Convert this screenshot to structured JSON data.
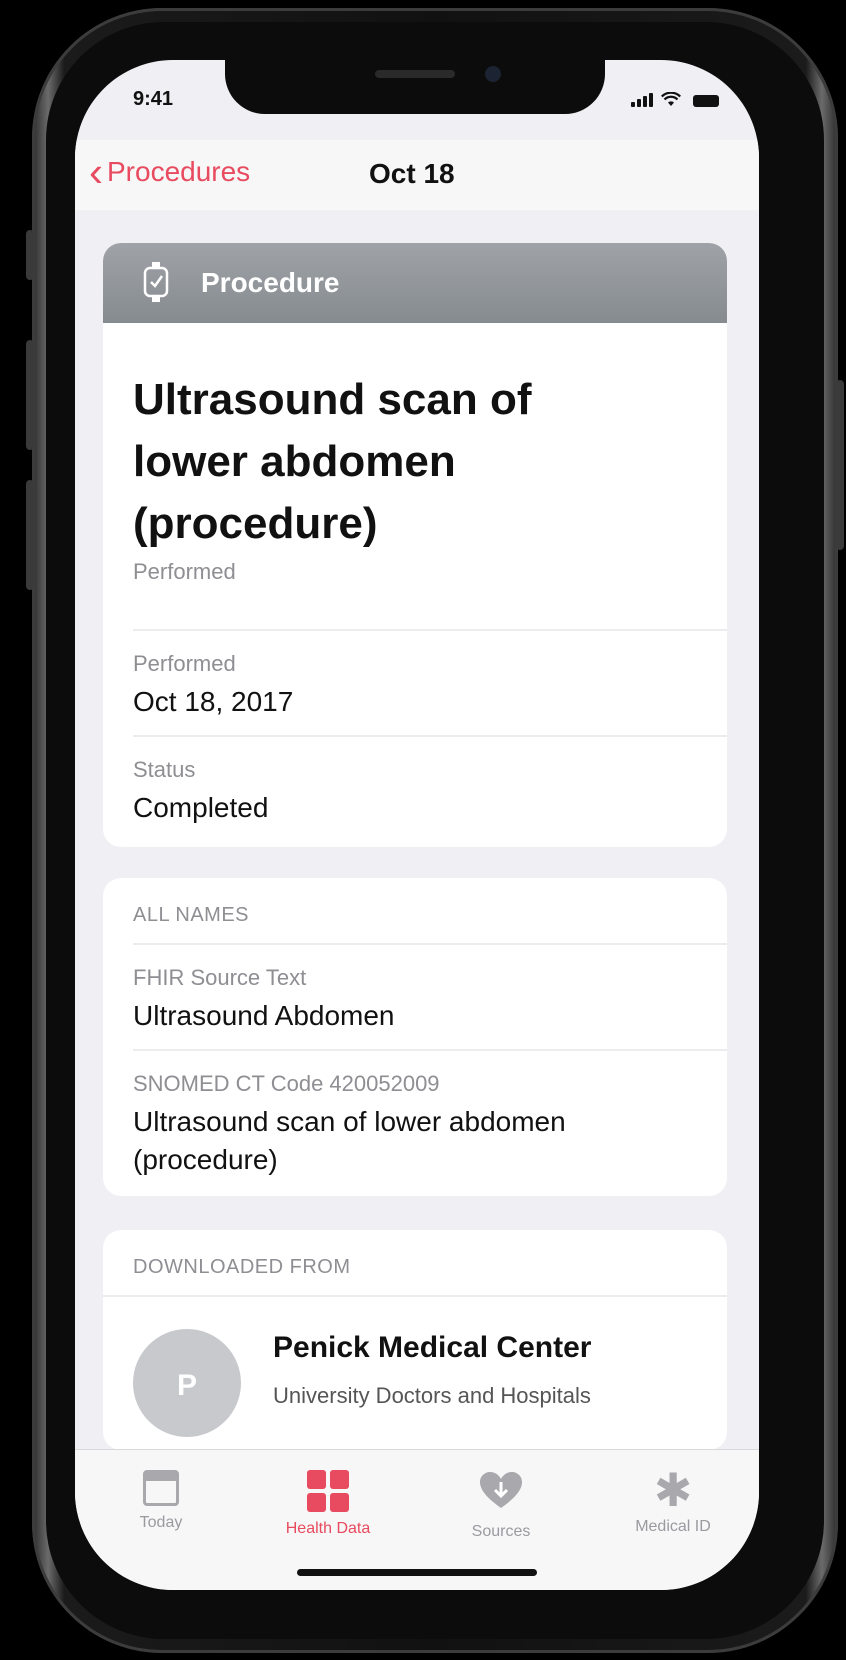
{
  "status_bar": {
    "time": "9:41"
  },
  "nav": {
    "back_label": "Procedures",
    "title": "Oct 18"
  },
  "procedure_card": {
    "header_label": "Procedure",
    "title_line1": "Ultrasound scan of",
    "title_line2": "lower abdomen",
    "title_line3": "(procedure)",
    "subtitle": "Performed",
    "rows": [
      {
        "key": "Performed",
        "value": "Oct 18, 2017"
      },
      {
        "key": "Status",
        "value": "Completed"
      }
    ]
  },
  "names_card": {
    "heading": "ALL NAMES",
    "rows": [
      {
        "key": "FHIR Source Text",
        "value": "Ultrasound Abdomen"
      },
      {
        "key": "SNOMED CT Code 420052009",
        "value_line1": "Ultrasound scan of lower abdomen",
        "value_line2": "(procedure)"
      }
    ]
  },
  "source_card": {
    "heading": "DOWNLOADED FROM",
    "avatar_letter": "P",
    "name": "Penick Medical Center",
    "organization": "University Doctors and Hospitals"
  },
  "tabbar": {
    "tabs": [
      {
        "label": "Today",
        "icon": "calendar-icon"
      },
      {
        "label": "Health Data",
        "icon": "grid-icon",
        "active": true
      },
      {
        "label": "Sources",
        "icon": "heart-icon"
      },
      {
        "label": "Medical ID",
        "icon": "asterisk-icon"
      }
    ]
  },
  "colors": {
    "accent": "#e84a5f",
    "header_gray": "#93979c",
    "background": "#efeff4"
  }
}
